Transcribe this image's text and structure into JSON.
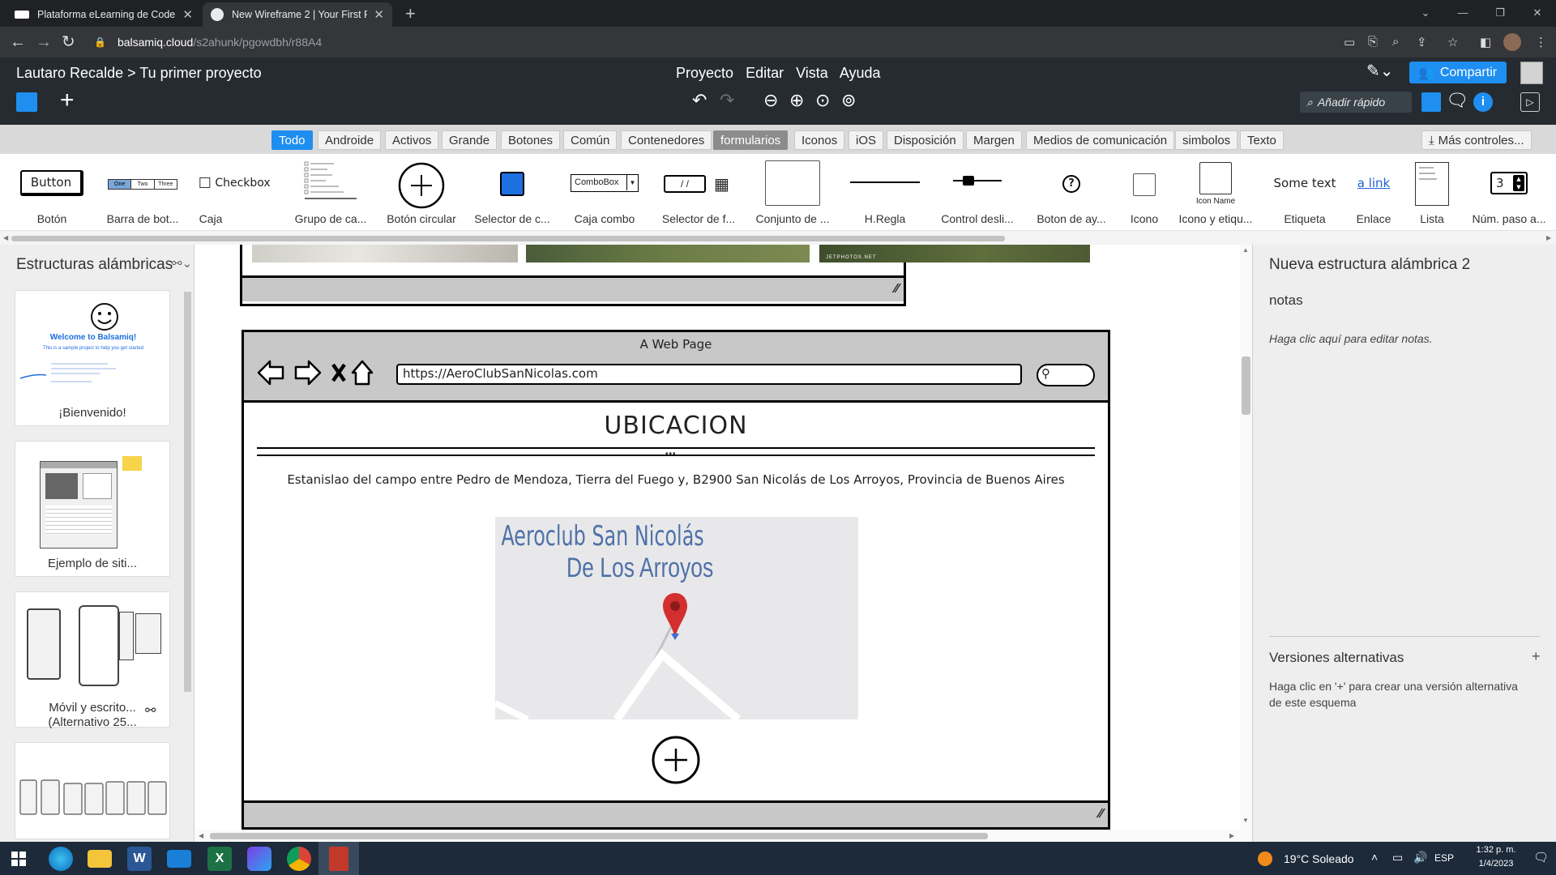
{
  "browser": {
    "tabs": [
      {
        "title": "Plataforma eLearning de Coderhouse",
        "active": false
      },
      {
        "title": "New Wireframe 2 | Your First Project",
        "active": true
      }
    ],
    "url_domain": "balsamiq.cloud",
    "url_path": "/s2ahunk/pgowdbh/r88A4"
  },
  "app": {
    "breadcrumb": "Lautaro Recalde > Tu primer proyecto",
    "menu": [
      "Proyecto",
      "Editar",
      "Vista",
      "Ayuda"
    ],
    "share_label": "Compartir",
    "quick_add_placeholder": "Añadir rápido"
  },
  "categories": [
    "Todo",
    "Androide",
    "Activos",
    "Grande",
    "Botones",
    "Común",
    "Contenedores",
    "formularios",
    "Iconos",
    "iOS",
    "Disposición",
    "Margen",
    "Medios de comunicación",
    "simbolos",
    "Texto"
  ],
  "more_controls": "Más controles...",
  "library": [
    {
      "label": "Botón",
      "preview": "Button"
    },
    {
      "label": "Barra de bot...",
      "preview": "One Two Three"
    },
    {
      "label": "Caja",
      "preview": "Checkbox"
    },
    {
      "label": "Grupo de ca...",
      "preview": ""
    },
    {
      "label": "Botón circular",
      "preview": ""
    },
    {
      "label": "Selector de c...",
      "preview": ""
    },
    {
      "label": "Caja combo",
      "preview": "ComboBox"
    },
    {
      "label": "Selector de f...",
      "preview": "/ /"
    },
    {
      "label": "Conjunto de ...",
      "preview": ""
    },
    {
      "label": "H.Regla",
      "preview": ""
    },
    {
      "label": "Control desli...",
      "preview": ""
    },
    {
      "label": "Boton de ay...",
      "preview": "?"
    },
    {
      "label": "Icono",
      "preview": ""
    },
    {
      "label": "Icono y etiqu...",
      "preview": "Icon Name"
    },
    {
      "label": "Etiqueta",
      "preview": "Some text"
    },
    {
      "label": "Enlace",
      "preview": "a link"
    },
    {
      "label": "Lista",
      "preview": ""
    },
    {
      "label": "Núm. paso a...",
      "preview": "3"
    }
  ],
  "left_panel": {
    "title": "Estructuras alámbricas",
    "thumbs": [
      {
        "caption": "¡Bienvenido!",
        "preview_title": "Welcome to Balsamiq!",
        "preview_sub": "This is a sample project to help you get started"
      },
      {
        "caption": "Ejemplo de siti..."
      },
      {
        "caption_line1": "Móvil y escrito...",
        "caption_line2": "(Alternativo 25..."
      },
      {
        "caption": ""
      }
    ]
  },
  "wireframe": {
    "photo_credit": "JETPHOTOS.NET",
    "browser_title": "A Web Page",
    "url": "https://AeroClubSanNicolas.com",
    "heading": "UBICACION",
    "address": "Estanislao del campo entre Pedro de Mendoza, Tierra del Fuego y, B2900 San Nicolás de Los Arroyos, Provincia de Buenos Aires",
    "map_line1": "Aeroclub San Nicolás",
    "map_line2": "De Los Arroyos"
  },
  "right_panel": {
    "title": "Nueva estructura alámbrica 2",
    "notes_label": "notas",
    "notes_hint": "Haga clic aquí para editar notas.",
    "alt_title": "Versiones alternativas",
    "alt_hint": "Haga clic en '+' para crear una versión alternativa de este esquema"
  },
  "taskbar": {
    "weather": "19°C  Soleado",
    "lang": "ESP",
    "time": "1:32 p. m.",
    "date": "1/4/2023"
  },
  "colors": {
    "accent": "#1e8ef0",
    "header_bg": "#252b30",
    "pin": "#d32f2f"
  }
}
